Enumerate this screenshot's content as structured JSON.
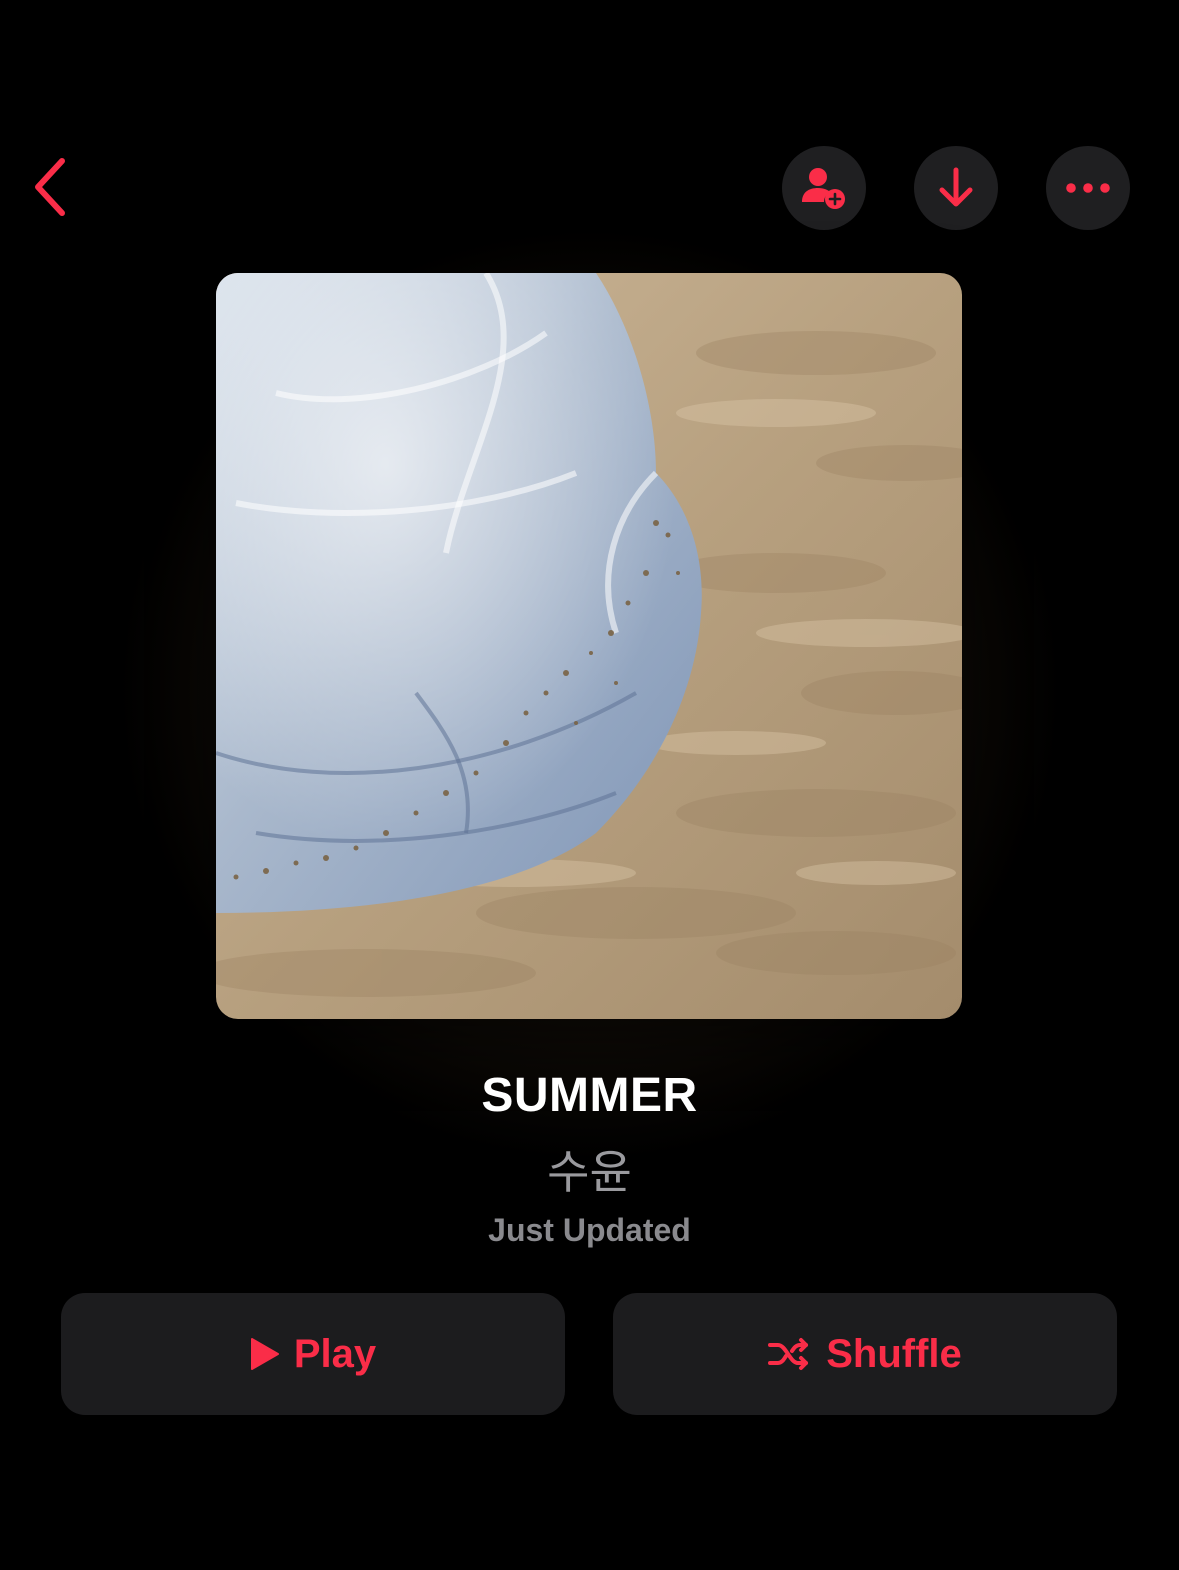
{
  "header": {
    "back_icon": "chevron-left-icon",
    "actions": [
      {
        "name": "add-collaborator",
        "icon": "person-plus-icon"
      },
      {
        "name": "download",
        "icon": "arrow-down-icon"
      },
      {
        "name": "more",
        "icon": "ellipsis-icon"
      }
    ]
  },
  "playlist": {
    "title": "SUMMER",
    "curator": "수윤",
    "status": "Just Updated"
  },
  "controls": {
    "play_label": "Play",
    "play_icon": "play-icon",
    "shuffle_label": "Shuffle",
    "shuffle_icon": "shuffle-icon"
  },
  "colors": {
    "accent": "#fa2d48",
    "background": "#000000",
    "button_bg": "#1c1c1e",
    "secondary_text": "#9a9a9e"
  }
}
